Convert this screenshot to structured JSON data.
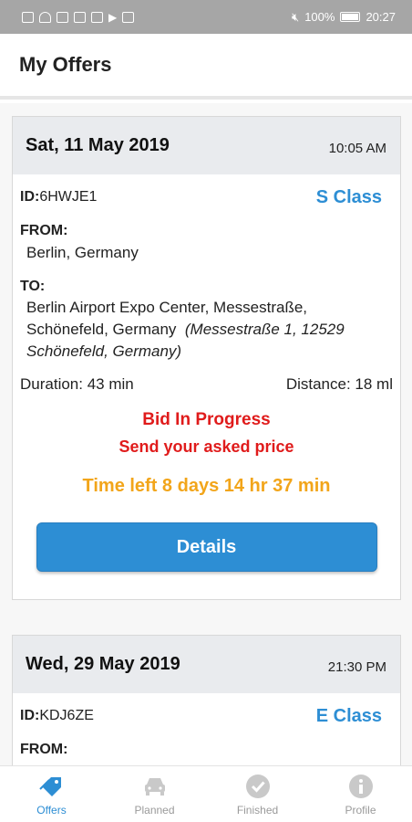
{
  "status_bar": {
    "battery": "100%",
    "time": "20:27"
  },
  "header": {
    "title": "My Offers"
  },
  "offers": [
    {
      "date": "Sat, 11 May 2019",
      "time": "10:05 AM",
      "id_label": "ID:",
      "id_value": "6HWJE1",
      "class": "S Class",
      "from_label": "FROM:",
      "from": "Berlin, Germany",
      "to_label": "TO:",
      "to_line1": "Berlin Airport Expo Center, Messestraße,",
      "to_line2": "Schönefeld, Germany",
      "to_note1": "(Messestraße 1, 12529",
      "to_note2": "Schönefeld, Germany)",
      "duration": "Duration: 43 min",
      "distance": "Distance: 18 ml",
      "status": "Bid In Progress",
      "status_sub": "Send your asked price",
      "time_left": "Time left 8 days 14 hr 37 min",
      "details_label": "Details"
    },
    {
      "date": "Wed, 29 May 2019",
      "time": "21:30 PM",
      "id_label": "ID:",
      "id_value": "KDJ6ZE",
      "class": "E Class",
      "from_label": "FROM:"
    }
  ],
  "bottom_nav": {
    "items": [
      {
        "label": "Offers",
        "icon": "tag-icon",
        "active": true
      },
      {
        "label": "Planned",
        "icon": "car-icon",
        "active": false
      },
      {
        "label": "Finished",
        "icon": "check-circle-icon",
        "active": false
      },
      {
        "label": "Profile",
        "icon": "info-circle-icon",
        "active": false
      }
    ]
  },
  "colors": {
    "accent": "#2d8ed4",
    "status_red": "#e01b1b",
    "time_left_orange": "#f2a51a"
  }
}
